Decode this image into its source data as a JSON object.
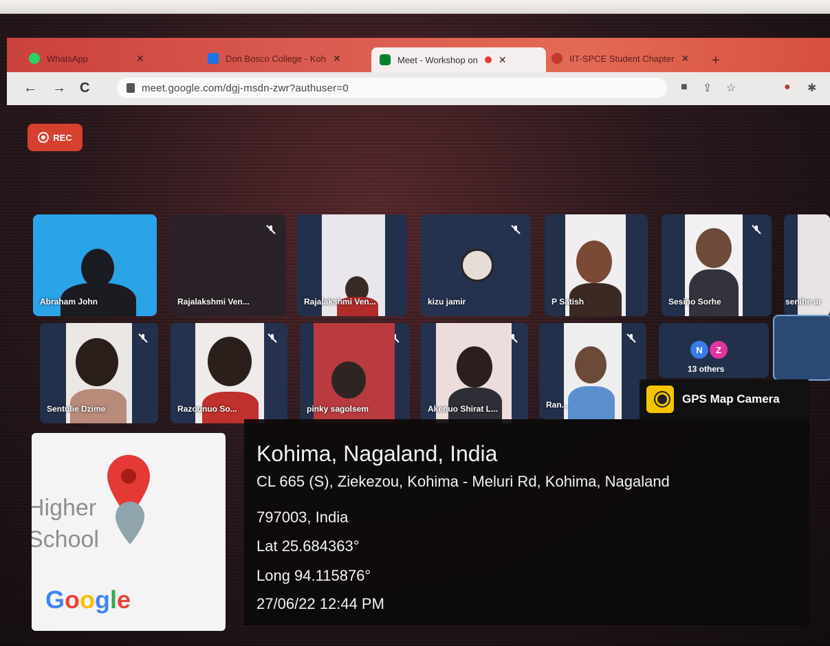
{
  "browser": {
    "tabs": [
      {
        "label": "WhatsApp",
        "favicon_color": "#25d366"
      },
      {
        "label": "Don Bosco College - Koh",
        "favicon_color": "#1a73e8"
      },
      {
        "label": "Meet - Workshop on",
        "favicon_color": "#00832d",
        "active": true
      },
      {
        "label": "IIT-SPCE Student Chapter",
        "favicon_color": "#c0392b"
      }
    ],
    "url": "meet.google.com/dgj-msdn-zwr?authuser=0"
  },
  "meet": {
    "rec_label": "REC",
    "participants_row1": [
      {
        "name": "Abraham John",
        "muted": false
      },
      {
        "name": "Rajalakshmi Ven...",
        "muted": true
      },
      {
        "name": "Rajalakshmi Ven...",
        "muted": false
      },
      {
        "name": "kizu jamir",
        "muted": true
      },
      {
        "name": "P Satish",
        "muted": false
      },
      {
        "name": "Sesino Sorhe",
        "muted": true
      },
      {
        "name": "senihe ar",
        "muted": false
      }
    ],
    "participants_row2": [
      {
        "name": "Sentulie Dzime",
        "muted": true
      },
      {
        "name": "Razounuo So...",
        "muted": true
      },
      {
        "name": "pinky sagolsem",
        "muted": true
      },
      {
        "name": "Akenuo Shirat L...",
        "muted": true
      },
      {
        "name": "Ran...",
        "muted": true
      }
    ],
    "others": {
      "label": "13 others",
      "avatars": [
        "N",
        "Z"
      ]
    }
  },
  "gps": {
    "app_name": "GPS Map Camera",
    "place": "Kohima, Nagaland, India",
    "address_line1": "CL 665 (S), Ziekezou, Kohima - Meluri Rd, Kohima, Nagaland",
    "address_line2": "797003, India",
    "lat": "Lat 25.684363°",
    "long": "Long 94.115876°",
    "datetime": "27/06/22 12:44 PM",
    "map_labels": [
      "Higher",
      "School"
    ],
    "map_logo": "Google"
  }
}
